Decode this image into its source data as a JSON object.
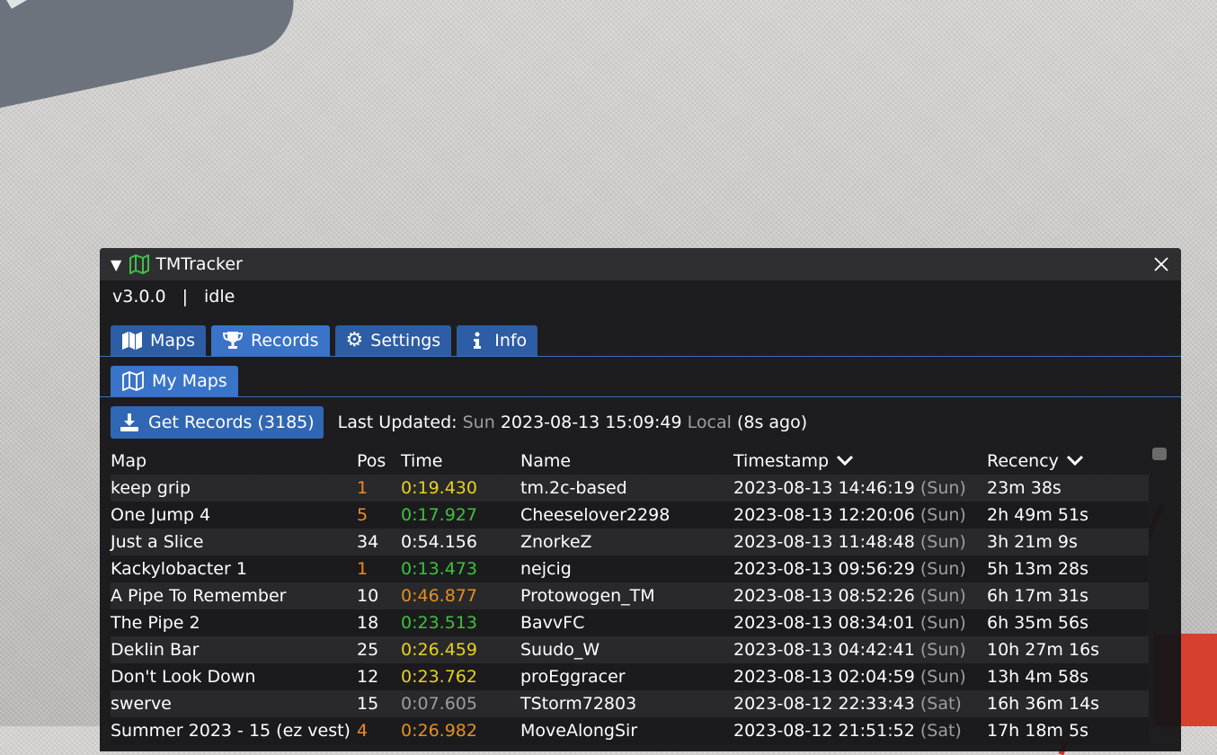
{
  "window": {
    "title": "TMTracker",
    "version": "v3.0.0",
    "separator": "|",
    "status": "idle"
  },
  "tabs": [
    {
      "label": "Maps",
      "icon": "map-icon"
    },
    {
      "label": "Records",
      "icon": "trophy-icon"
    },
    {
      "label": "Settings",
      "icon": "gear-icon"
    },
    {
      "label": "Info",
      "icon": "info-icon"
    }
  ],
  "subtabs": [
    {
      "label": "My Maps",
      "icon": "map-outline-icon"
    }
  ],
  "toolbar": {
    "get_records_label": "Get Records (3185)",
    "last_updated_label": "Last Updated:",
    "day": "Sun",
    "datetime": "2023-08-13 15:09:49",
    "zone": "Local",
    "ago": "(8s ago)"
  },
  "table": {
    "headers": {
      "map": "Map",
      "pos": "Pos",
      "time": "Time",
      "name": "Name",
      "timestamp": "Timestamp",
      "recency": "Recency"
    },
    "rows": [
      {
        "map": "keep grip",
        "pos": "1",
        "time": "0:19.430",
        "name": "tm.2c-based",
        "ts": "2023-08-13 14:46:19",
        "day": "(Sun)",
        "recency": "23m 38s"
      },
      {
        "map": "One Jump 4",
        "pos": "5",
        "time": "0:17.927",
        "name": "Cheeselover2298",
        "ts": "2023-08-13 12:20:06",
        "day": "(Sun)",
        "recency": "2h 49m 51s"
      },
      {
        "map": "Just a Slice",
        "pos": "34",
        "time": "0:54.156",
        "name": "ZnorkeZ",
        "ts": "2023-08-13 11:48:48",
        "day": "(Sun)",
        "recency": "3h 21m 9s"
      },
      {
        "map": "Kackylobacter 1",
        "pos": "1",
        "time": "0:13.473",
        "name": "nejcig",
        "ts": "2023-08-13 09:56:29",
        "day": "(Sun)",
        "recency": "5h 13m 28s"
      },
      {
        "map": "A Pipe To Remember",
        "pos": "10",
        "time": "0:46.877",
        "name": "Protowogen_TM",
        "ts": "2023-08-13 08:52:26",
        "day": "(Sun)",
        "recency": "6h 17m 31s"
      },
      {
        "map": "The Pipe 2",
        "pos": "18",
        "time": "0:23.513",
        "name": "BavvFC",
        "ts": "2023-08-13 08:34:01",
        "day": "(Sun)",
        "recency": "6h 35m 56s"
      },
      {
        "map": "Deklin Bar",
        "pos": "25",
        "time": "0:26.459",
        "name": "Suudo_W",
        "ts": "2023-08-13 04:42:41",
        "day": "(Sun)",
        "recency": "10h 27m 16s"
      },
      {
        "map": "Don't Look Down",
        "pos": "12",
        "time": "0:23.762",
        "name": "proEggracer",
        "ts": "2023-08-13 02:04:59",
        "day": "(Sun)",
        "recency": "13h 4m 58s"
      },
      {
        "map": "swerve",
        "pos": "15",
        "time": "0:07.605",
        "name": "TStorm72803",
        "ts": "2023-08-12 22:33:43",
        "day": "(Sat)",
        "recency": "16h 36m 14s"
      },
      {
        "map": "Summer 2023 - 15 (ez vest)",
        "pos": "4",
        "time": "0:26.982",
        "name": "MoveAlongSir",
        "ts": "2023-08-12 21:51:52",
        "day": "(Sat)",
        "recency": "17h 18m 5s"
      }
    ]
  },
  "colors": {
    "window_bg": "#161618",
    "tab_active": "#3a74c9",
    "tab": "#2d5da4",
    "medal_orange": "#ef8a22",
    "medal_yellow": "#e6d21f",
    "medal_green": "#3fc13b",
    "medal_gray": "#9d9d9d",
    "map_icon_green": "#3fbf4a"
  }
}
